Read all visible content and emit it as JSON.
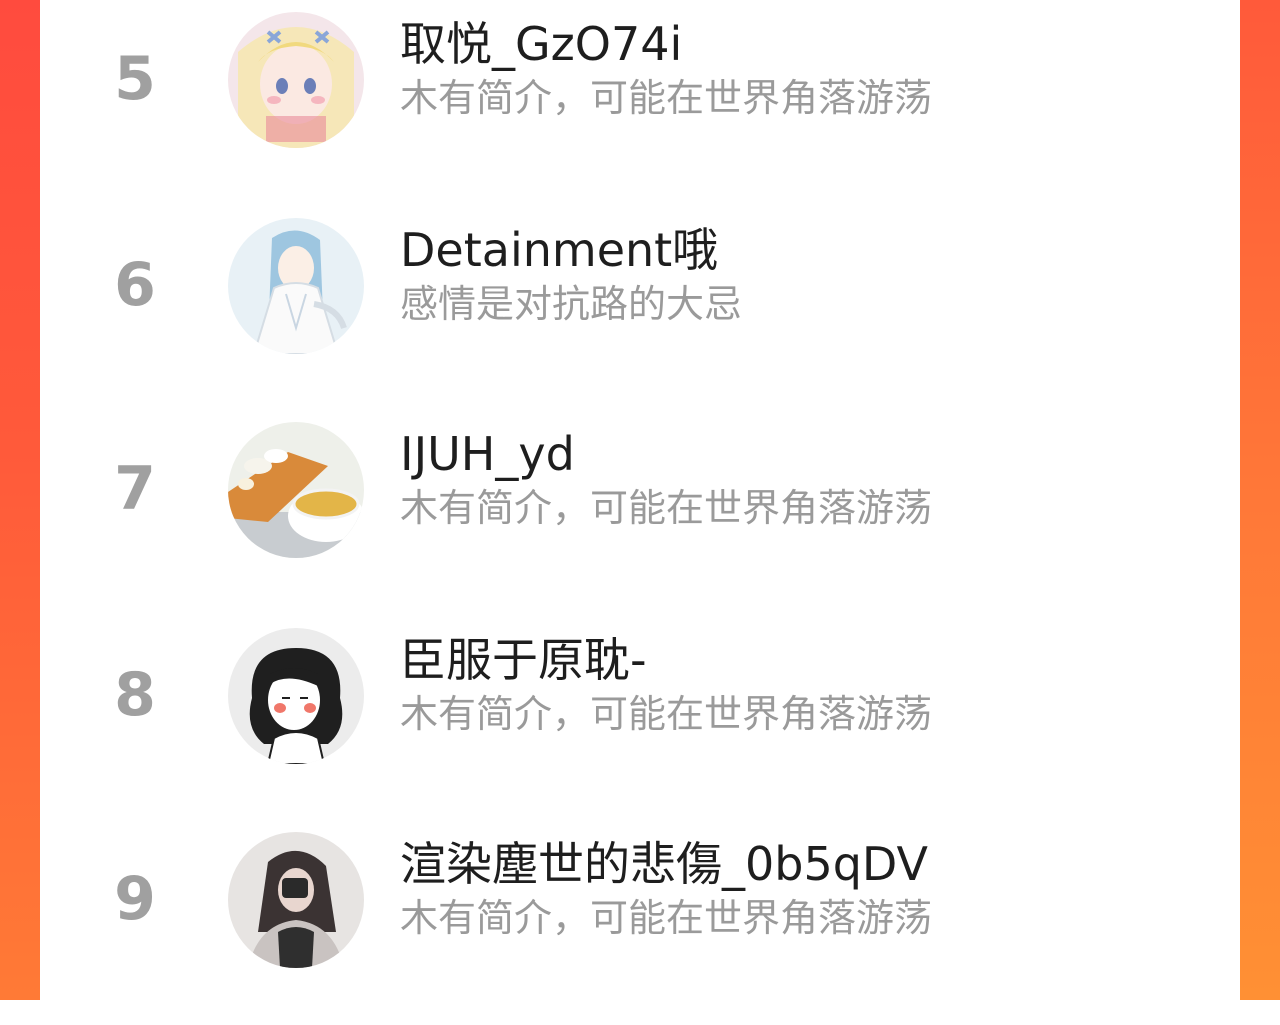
{
  "colors": {
    "frame_top": "#ff4b3e",
    "frame_bottom": "#ff8a34",
    "panel": "#ffffff",
    "rank": "#a0a0a0",
    "name": "#1e1e1e",
    "bio": "#9a9a9a"
  },
  "ranking": {
    "items": [
      {
        "rank": "5",
        "name": "取悦_GzO74i",
        "bio": "木有简介，可能在世界角落游荡",
        "avatar_icon": "anime-girl-blonde-avatar"
      },
      {
        "rank": "6",
        "name": "Detainment哦",
        "bio": "感情是对抗路的大忌",
        "avatar_icon": "anime-boy-blue-hair-avatar"
      },
      {
        "rank": "7",
        "name": "IJUH_yd",
        "bio": "木有简介，可能在世界角落游荡",
        "avatar_icon": "tea-cup-avatar"
      },
      {
        "rank": "8",
        "name": "臣服于原耽-",
        "bio": "木有简介，可能在世界角落游荡",
        "avatar_icon": "cartoon-girl-curly-hair-avatar"
      },
      {
        "rank": "9",
        "name": "渲染塵世的悲傷_0b5qDV",
        "bio": "木有简介，可能在世界角落游荡",
        "avatar_icon": "girl-photo-avatar"
      }
    ]
  }
}
